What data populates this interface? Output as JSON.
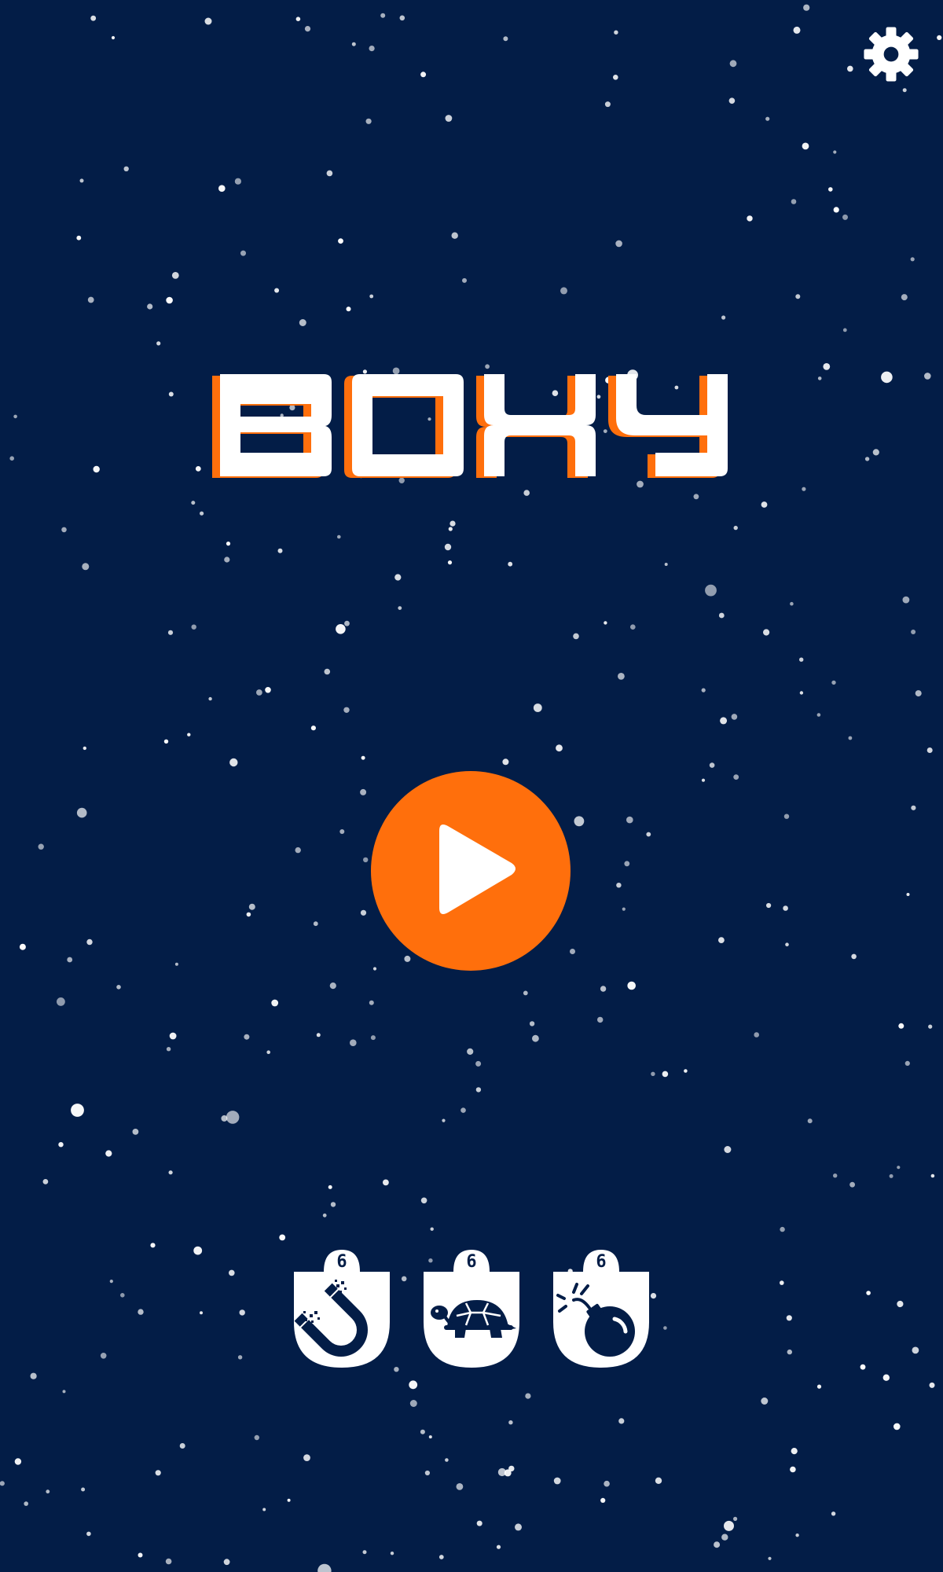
{
  "game": {
    "title": "BOXY"
  },
  "colors": {
    "background": "#031d47",
    "accent": "#ff6f0c",
    "foreground": "#ffffff"
  },
  "settings": {
    "icon": "gear-icon"
  },
  "play": {
    "icon": "play-icon"
  },
  "powerups": [
    {
      "name": "magnet",
      "icon": "magnet-icon",
      "count": "6"
    },
    {
      "name": "slow",
      "icon": "turtle-icon",
      "count": "6"
    },
    {
      "name": "bomb",
      "icon": "bomb-icon",
      "count": "6"
    }
  ]
}
